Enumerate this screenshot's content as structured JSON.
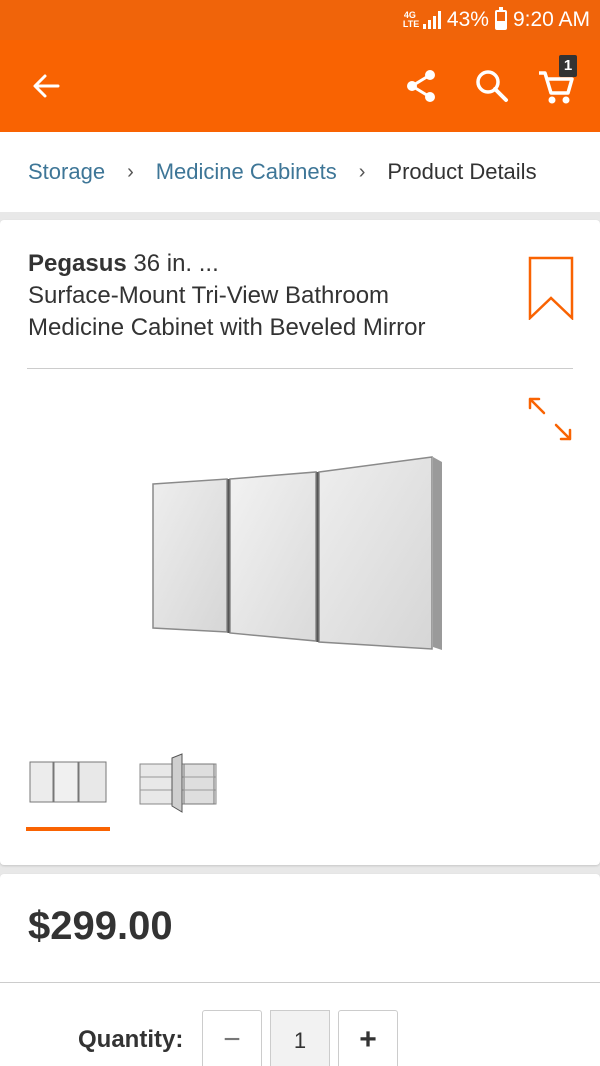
{
  "status_bar": {
    "network": "4G LTE",
    "battery_percent": "43%",
    "battery_level": 0.43,
    "time": "9:20 AM",
    "color": "#f0640a"
  },
  "app_bar": {
    "color": "#f96302",
    "icons": [
      "back-arrow-icon",
      "share-icon",
      "search-icon",
      "cart-icon"
    ],
    "cart_count": "1"
  },
  "breadcrumb": {
    "items": [
      "Storage",
      "Medicine Cabinets",
      "Product Details"
    ],
    "separator": "›",
    "link_color": "#3e7697"
  },
  "product": {
    "brand": "Pegasus",
    "title_rest": " 36 in. ...",
    "title_line2": "Surface-Mount Tri-View Bathroom",
    "title_line3": "Medicine Cabinet with Beveled Mirror",
    "icons": [
      "bookmark-icon",
      "expand-icon"
    ],
    "thumbnails": [
      "cabinet-closed",
      "cabinet-open"
    ],
    "selected_thumbnail": 0
  },
  "pricing": {
    "price": "$299.00"
  },
  "quantity": {
    "label": "Quantity:",
    "minus": "−",
    "value": "1",
    "plus": "+"
  }
}
